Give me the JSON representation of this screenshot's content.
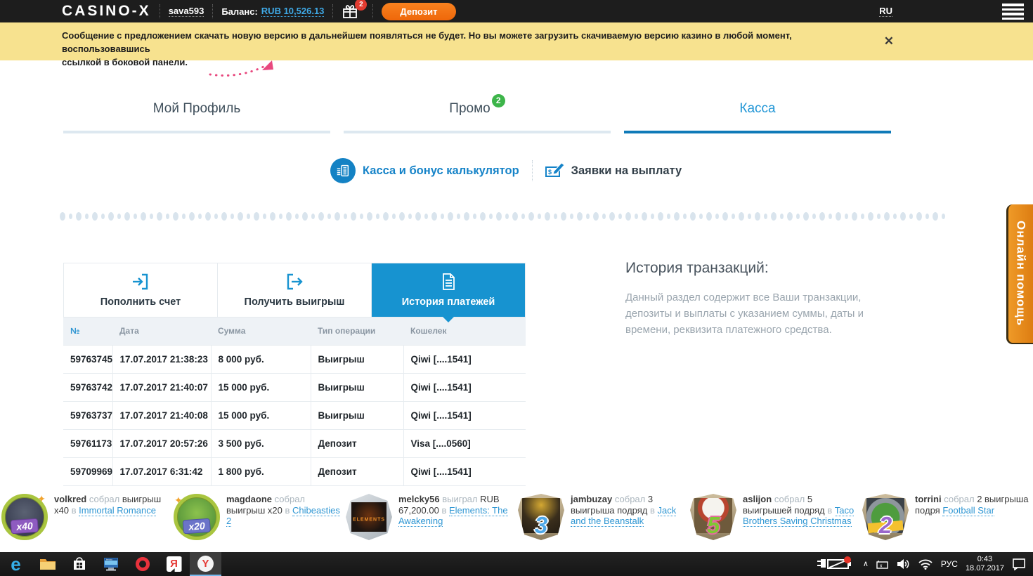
{
  "colors": {
    "accent_blue": "#1793d0",
    "link_blue": "#2e95d2",
    "deposit_orange": "#f1700f",
    "banner_yellow": "#f7e28f",
    "help_orange": "#e0831c",
    "promo_badge_green": "#3db54a",
    "gift_badge_red": "#e23b30"
  },
  "header": {
    "logo": "CASINO-X",
    "username": "sava593",
    "balance_label": "Баланс:",
    "balance_value": "RUB 10,526.13",
    "gift_badge": "2",
    "deposit_button": "Депозит",
    "language": "RU"
  },
  "banner": {
    "line1": "Сообщение с предложением скачать новую версию в дальнейшем появляться не будет. Но вы можете загрузить скачиваемую версию казино в любой момент, воспользовавшись",
    "line2": "ссылкой в боковой панели.",
    "close": "✕"
  },
  "tabs": [
    {
      "label": "Мой Профиль",
      "active": false
    },
    {
      "label": "Промо",
      "badge": "2",
      "active": false
    },
    {
      "label": "Касса",
      "active": true
    }
  ],
  "subnav": {
    "cashier_label": "Касса и бонус калькулятор",
    "payouts_label": "Заявки на выплату"
  },
  "panel": {
    "tabs": [
      {
        "label": "Пополнить счет",
        "icon": "arrow-in-icon",
        "active": false
      },
      {
        "label": "Получить выигрыш",
        "icon": "arrow-out-icon",
        "active": false
      },
      {
        "label": "История платежей",
        "icon": "document-icon",
        "active": true
      }
    ],
    "table": {
      "headers": [
        "№",
        "Дата",
        "Сумма",
        "Тип операции",
        "Кошелек"
      ],
      "rows": [
        [
          "59763745",
          "17.07.2017 21:38:23",
          "8 000 руб.",
          "Выигрыш",
          "Qiwi [....1541]"
        ],
        [
          "59763742",
          "17.07.2017 21:40:07",
          "15 000 руб.",
          "Выигрыш",
          "Qiwi [....1541]"
        ],
        [
          "59763737",
          "17.07.2017 21:40:08",
          "15 000 руб.",
          "Выигрыш",
          "Qiwi [....1541]"
        ],
        [
          "59761173",
          "17.07.2017 20:57:26",
          "3 500 руб.",
          "Депозит",
          "Visa [....0560]"
        ],
        [
          "59709969",
          "17.07.2017 6:31:42",
          "1 800 руб.",
          "Депозит",
          "Qiwi [....1541]"
        ]
      ]
    }
  },
  "history_info": {
    "title": "История транзакций:",
    "description": "Данный раздел содержит все Ваши транзакции, депозиты и выплаты с указанием суммы, даты и времени, реквизита платежного средства."
  },
  "help_button": {
    "label": "Онлайн помощь"
  },
  "winners": [
    {
      "user": "volkred",
      "verb": "собрал",
      "amount": "выигрыш x40",
      "conj": "в",
      "game": "Immortal Romance",
      "badge": {
        "label": "x40",
        "style": "badge-x40"
      }
    },
    {
      "user": "magdaone",
      "verb": "собрал",
      "amount": "выигрыш x20",
      "conj": "в",
      "game": "Chibeasties 2",
      "badge": {
        "label": "x20",
        "style": "badge-x20"
      }
    },
    {
      "user": "melcky56",
      "verb": "выиграл",
      "amount": "RUB 67,200.00",
      "conj": "в",
      "game": "Elements: The Awakening",
      "badge": {
        "label": "ELEMENTS",
        "style": "badge-elements"
      }
    },
    {
      "user": "jambuzay",
      "verb": "собрал",
      "amount": "3 выигрыша подряд",
      "conj": "в",
      "game": "Jack and the Beanstalk",
      "badge": {
        "label": "3",
        "style": "badge-3"
      }
    },
    {
      "user": "aslijon",
      "verb": "собрал",
      "amount": "5 выигрышей подряд",
      "conj": "в",
      "game": "Taco Brothers Saving Christmas",
      "badge": {
        "label": "5",
        "style": "badge-5"
      }
    },
    {
      "user": "torrini",
      "verb": "собрал",
      "amount": "2 выигрыша подря",
      "conj": "",
      "game": "Football Star",
      "badge": {
        "label": "2",
        "style": "badge-2"
      }
    }
  ],
  "taskbar": {
    "app_icons": [
      "edge-icon",
      "file-explorer-icon",
      "windows-store-icon",
      "monitor-icon",
      "opera-icon",
      "yandex-icon",
      "yandex-browser-icon"
    ],
    "active_app": "yandex-browser-icon",
    "tray_icons": [
      "battery-charging-icon",
      "chevron-up-icon",
      "input-indicator-icon",
      "volume-icon",
      "wifi-icon",
      "action-center-icon"
    ],
    "language": "РУС",
    "time": "0:43",
    "date": "18.07.2017"
  }
}
